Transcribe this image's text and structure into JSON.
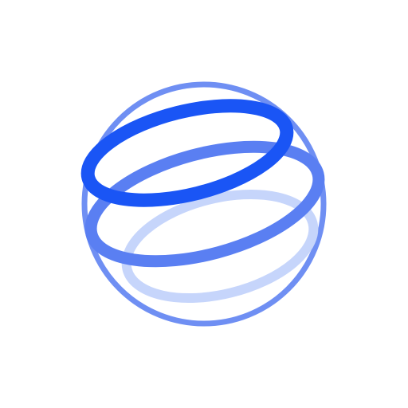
{
  "logo": {
    "icon": "globe-rings-icon",
    "colors": {
      "outline": "#6f8ff3",
      "ring_top": "#1a55f5",
      "ring_middle": "#5a7ff2",
      "ring_bottom": "#c6d5fb"
    }
  }
}
